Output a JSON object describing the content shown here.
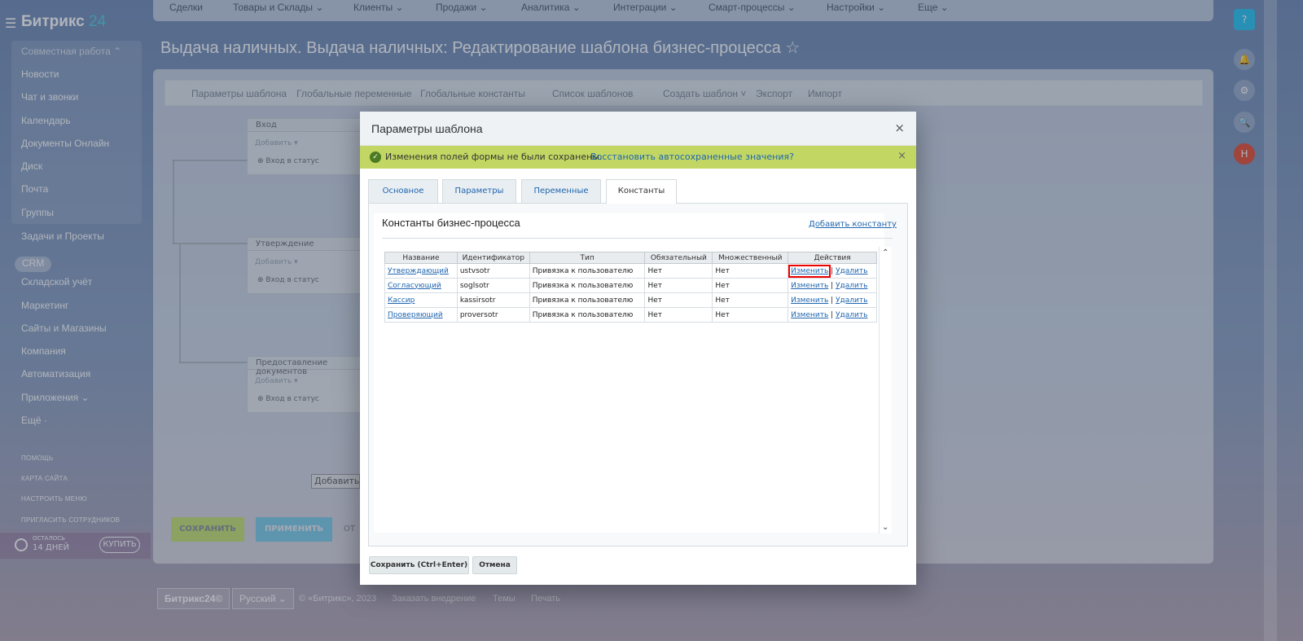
{
  "app": {
    "logo": "Битрикс",
    "logo_num": "24"
  },
  "sidebar": {
    "items": [
      "Совместная работа ⌃",
      "Новости",
      "Чат и звонки",
      "Календарь",
      "Документы Онлайн",
      "Диск",
      "Почта",
      "Группы",
      "Задачи и Проекты",
      "CRM",
      "Складской учёт",
      "Маркетинг",
      "Сайты и Магазины",
      "Компания",
      "Автоматизация",
      "Приложения ⌄",
      "Ещё ·"
    ],
    "bottom": [
      "ПОМОЩЬ",
      "КАРТА САЙТА",
      "НАСТРОИТЬ МЕНЮ",
      "ПРИГЛАСИТЬ СОТРУДНИКОВ"
    ],
    "trial_line1": "ОСТАЛОСЬ",
    "trial_line2": "14 ДНЕЙ",
    "buy": "КУПИТЬ"
  },
  "topnav": [
    "Сделки",
    "Товары и Склады ⌄",
    "Клиенты ⌄",
    "Продажи ⌄",
    "Аналитика ⌄",
    "Интеграции ⌄",
    "Смарт-процессы ⌄",
    "Настройки ⌄",
    "Еще ⌄"
  ],
  "page": {
    "title": "Выдача наличных. Выдача наличных: Редактирование шаблона бизнес-процесса ☆"
  },
  "toolbar": [
    "Параметры шаблона",
    "Глобальные переменные",
    "Глобальные константы",
    "Список шаблонов",
    "Создать шаблон ˅",
    "Экспорт",
    "Импорт"
  ],
  "workflow": [
    {
      "title": "Вход",
      "add": "Добавить ▾",
      "item": "⊕ Вход в статус"
    },
    {
      "title": "Утверждение",
      "add": "Добавить ▾",
      "item": "⊕ Вход в статус"
    },
    {
      "title": "Предоставление документов",
      "add": "Добавить ▾",
      "item": "⊕ Вход в статус"
    }
  ],
  "add_button": "Добавить",
  "save": "СОХРАНИТЬ",
  "apply": "ПРИМЕНИТЬ",
  "cancel_partial": "ОТ",
  "footer": {
    "brand": "Битрикс24©",
    "lang": "Русский ⌄",
    "copy": "© «Битрикс», 2023",
    "order": "Заказать внедрение",
    "theme": "Темы",
    "print": "Печать"
  },
  "dialog": {
    "title": "Параметры шаблона",
    "close": "×",
    "notice": {
      "message": "Изменения полей формы не были сохранены.",
      "link": "Восстановить автосохраненные значения?",
      "close": "×"
    },
    "tabs": [
      "Основное",
      "Параметры",
      "Переменные",
      "Константы"
    ],
    "active_tab": "Константы",
    "section_title": "Константы бизнес-процесса",
    "add_constant": "Добавить константу",
    "columns": [
      "Название",
      "Идентификатор",
      "Тип",
      "Обязательный",
      "Множественный",
      "Действия"
    ],
    "rows": [
      {
        "name": "Утверждающий",
        "id": "ustvsotr",
        "type": "Привязка к пользователю",
        "required": "Нет",
        "multiple": "Нет",
        "edit": "Изменить",
        "sep": "|",
        "del": "Удалить"
      },
      {
        "name": "Согласующий",
        "id": "soglsotr",
        "type": "Привязка к пользователю",
        "required": "Нет",
        "multiple": "Нет",
        "edit": "Изменить",
        "sep": "|",
        "del": "Удалить"
      },
      {
        "name": "Кассир",
        "id": "kassirsotr",
        "type": "Привязка к пользователю",
        "required": "Нет",
        "multiple": "Нет",
        "edit": "Изменить",
        "sep": "|",
        "del": "Удалить"
      },
      {
        "name": "Проверяющий",
        "id": "proversotr",
        "type": "Привязка к пользователю",
        "required": "Нет",
        "multiple": "Нет",
        "edit": "Изменить",
        "sep": "|",
        "del": "Удалить"
      }
    ],
    "save_button": "Сохранить (Ctrl+Enter)",
    "cancel_button": "Отмена"
  },
  "right_icons": [
    "?",
    "🔔",
    "⚙",
    "🔍",
    "Н"
  ],
  "colors": {
    "notice_bg": "#c2d763",
    "link": "#2066b0",
    "highlight": "#e00000"
  }
}
